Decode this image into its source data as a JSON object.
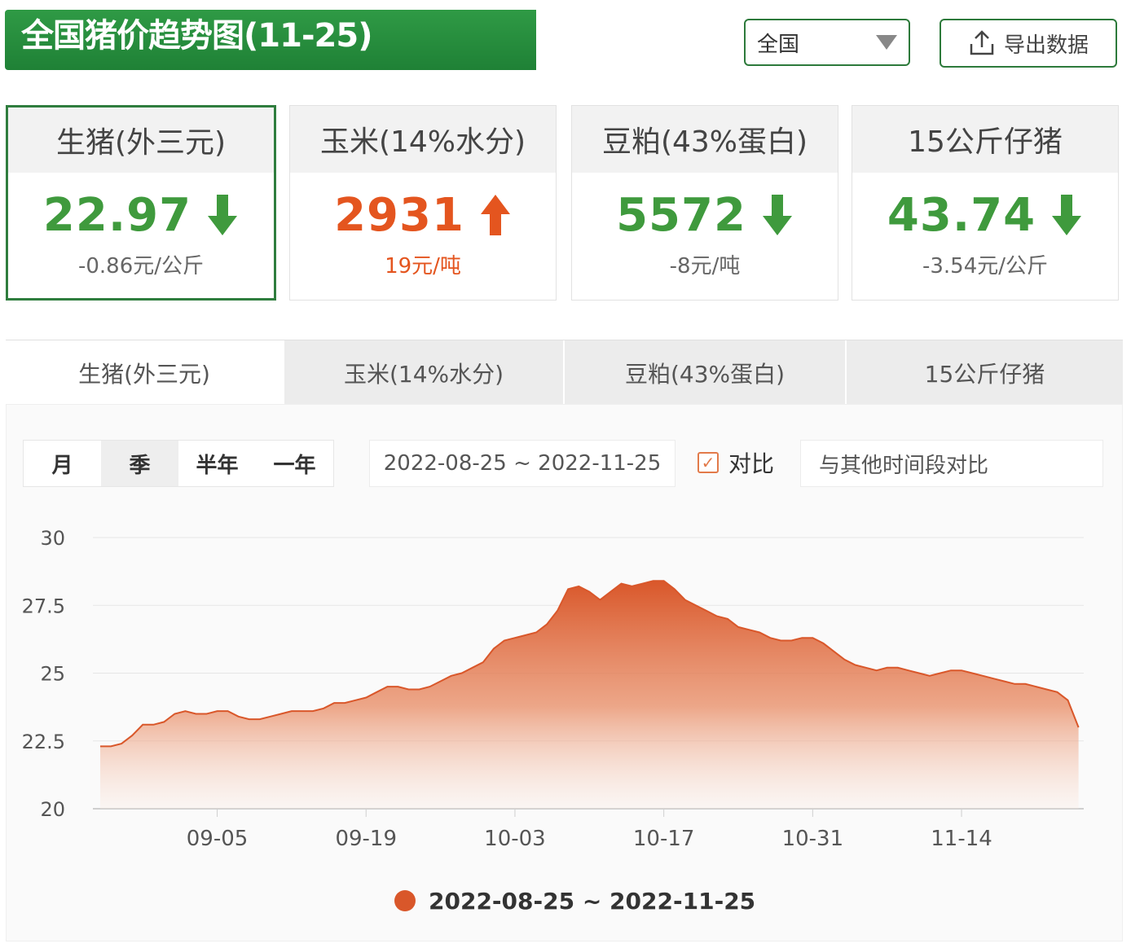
{
  "header": {
    "title": "全国猪价趋势图(11-25)"
  },
  "region": {
    "selected": "全国"
  },
  "export": {
    "label": "导出数据",
    "icon": "upload-icon"
  },
  "cards": [
    {
      "name": "生猪(外三元)",
      "value": "22.97",
      "direction": "down",
      "change": "-0.86元/公斤"
    },
    {
      "name": "玉米(14%水分)",
      "value": "2931",
      "direction": "up",
      "change": "19元/吨"
    },
    {
      "name": "豆粕(43%蛋白)",
      "value": "5572",
      "direction": "down",
      "change": "-8元/吨"
    },
    {
      "name": "15公斤仔猪",
      "value": "43.74",
      "direction": "down",
      "change": "-3.54元/公斤"
    }
  ],
  "tabs": [
    "生猪(外三元)",
    "玉米(14%水分)",
    "豆粕(43%蛋白)",
    "15公斤仔猪"
  ],
  "periods": [
    "月",
    "季",
    "半年",
    "一年"
  ],
  "date_range": "2022-08-25 ~ 2022-11-25",
  "compare": {
    "label": "对比",
    "checked": true,
    "other_placeholder": "与其他时间段对比"
  },
  "colors": {
    "brand_green": "#1f8136",
    "down": "#3f9a3d",
    "up": "#e4551f",
    "series": "#d9572a"
  },
  "chart_data": {
    "type": "area",
    "y_ticks": [
      "30",
      "27.5",
      "25",
      "22.5",
      "20"
    ],
    "ylim": [
      20,
      30
    ],
    "x_ticks": [
      "09-05",
      "09-19",
      "10-03",
      "10-17",
      "10-31",
      "11-14"
    ],
    "legend": "2022-08-25 ~ 2022-11-25",
    "series": [
      {
        "x": [
          "08-25",
          "08-26",
          "08-27",
          "08-28",
          "08-29",
          "08-30",
          "08-31",
          "09-01",
          "09-02",
          "09-03",
          "09-04",
          "09-05",
          "09-06",
          "09-07",
          "09-08",
          "09-09",
          "09-10",
          "09-11",
          "09-12",
          "09-13",
          "09-14",
          "09-15",
          "09-16",
          "09-17",
          "09-18",
          "09-19",
          "09-20",
          "09-21",
          "09-22",
          "09-23",
          "09-24",
          "09-25",
          "09-26",
          "09-27",
          "09-28",
          "09-29",
          "09-30",
          "10-01",
          "10-02",
          "10-03",
          "10-04",
          "10-05",
          "10-06",
          "10-07",
          "10-08",
          "10-09",
          "10-10",
          "10-11",
          "10-12",
          "10-13",
          "10-14",
          "10-15",
          "10-16",
          "10-17",
          "10-18",
          "10-19",
          "10-20",
          "10-21",
          "10-22",
          "10-23",
          "10-24",
          "10-25",
          "10-26",
          "10-27",
          "10-28",
          "10-29",
          "10-30",
          "10-31",
          "11-01",
          "11-02",
          "11-03",
          "11-04",
          "11-05",
          "11-06",
          "11-07",
          "11-08",
          "11-09",
          "11-10",
          "11-11",
          "11-12",
          "11-13",
          "11-14",
          "11-15",
          "11-16",
          "11-17",
          "11-18",
          "11-19",
          "11-20",
          "11-21",
          "11-22",
          "11-23",
          "11-24",
          "11-25"
        ],
        "values": [
          22.3,
          22.3,
          22.4,
          22.7,
          23.1,
          23.1,
          23.2,
          23.5,
          23.6,
          23.5,
          23.5,
          23.6,
          23.6,
          23.4,
          23.3,
          23.3,
          23.4,
          23.5,
          23.6,
          23.6,
          23.6,
          23.7,
          23.9,
          23.9,
          24.0,
          24.1,
          24.3,
          24.5,
          24.5,
          24.4,
          24.4,
          24.5,
          24.7,
          24.9,
          25.0,
          25.2,
          25.4,
          25.9,
          26.2,
          26.3,
          26.4,
          26.5,
          26.8,
          27.3,
          28.1,
          28.2,
          28.0,
          27.7,
          28.0,
          28.3,
          28.2,
          28.3,
          28.4,
          28.4,
          28.1,
          27.7,
          27.5,
          27.3,
          27.1,
          27.0,
          26.7,
          26.6,
          26.5,
          26.3,
          26.2,
          26.2,
          26.3,
          26.3,
          26.1,
          25.8,
          25.5,
          25.3,
          25.2,
          25.1,
          25.2,
          25.2,
          25.1,
          25.0,
          24.9,
          25.0,
          25.1,
          25.1,
          25.0,
          24.9,
          24.8,
          24.7,
          24.6,
          24.6,
          24.5,
          24.4,
          24.3,
          24.0,
          23.0
        ]
      }
    ]
  }
}
